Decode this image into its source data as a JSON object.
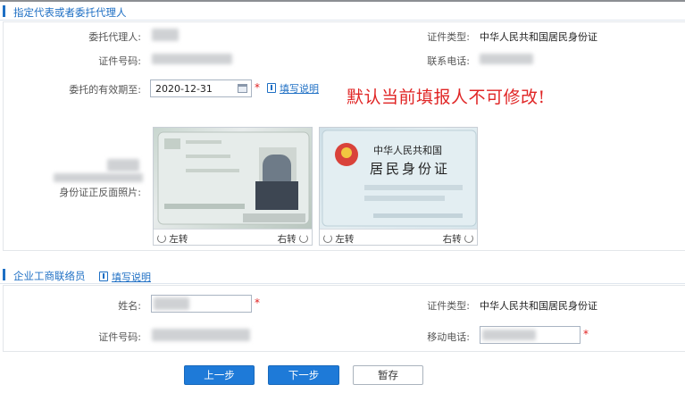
{
  "section1": {
    "title": "指定代表或者委托代理人",
    "agent_label": "委托代理人:",
    "id_type_label": "证件类型:",
    "id_type_value": "中华人民共和国居民身份证",
    "id_number_label": "证件号码:",
    "phone_label": "联系电话:",
    "validity_label": "委托的有效期至:",
    "validity_value": "2020-12-31",
    "required_mark": "*",
    "help_label": "填写说明",
    "annotation": "默认当前填报人不可修改!",
    "id_photo_label": "身份证正反面照片:",
    "rotate_left": "左转",
    "rotate_right": "右转",
    "card_back_title": "中华人民共和国",
    "card_back_subtitle": "居民身份证"
  },
  "section2": {
    "title": "企业工商联络员",
    "help_label": "填写说明",
    "name_label": "姓名:",
    "id_type_label": "证件类型:",
    "id_type_value": "中华人民共和国居民身份证",
    "id_number_label": "证件号码:",
    "mobile_label": "移动电话:",
    "required_mark": "*"
  },
  "buttons": {
    "prev": "上一步",
    "next": "下一步",
    "save": "暂存"
  },
  "colors": {
    "accent": "#1e6fc4",
    "primary_button": "#1e7ad8",
    "required": "#e02020",
    "annotation": "#e02525"
  }
}
